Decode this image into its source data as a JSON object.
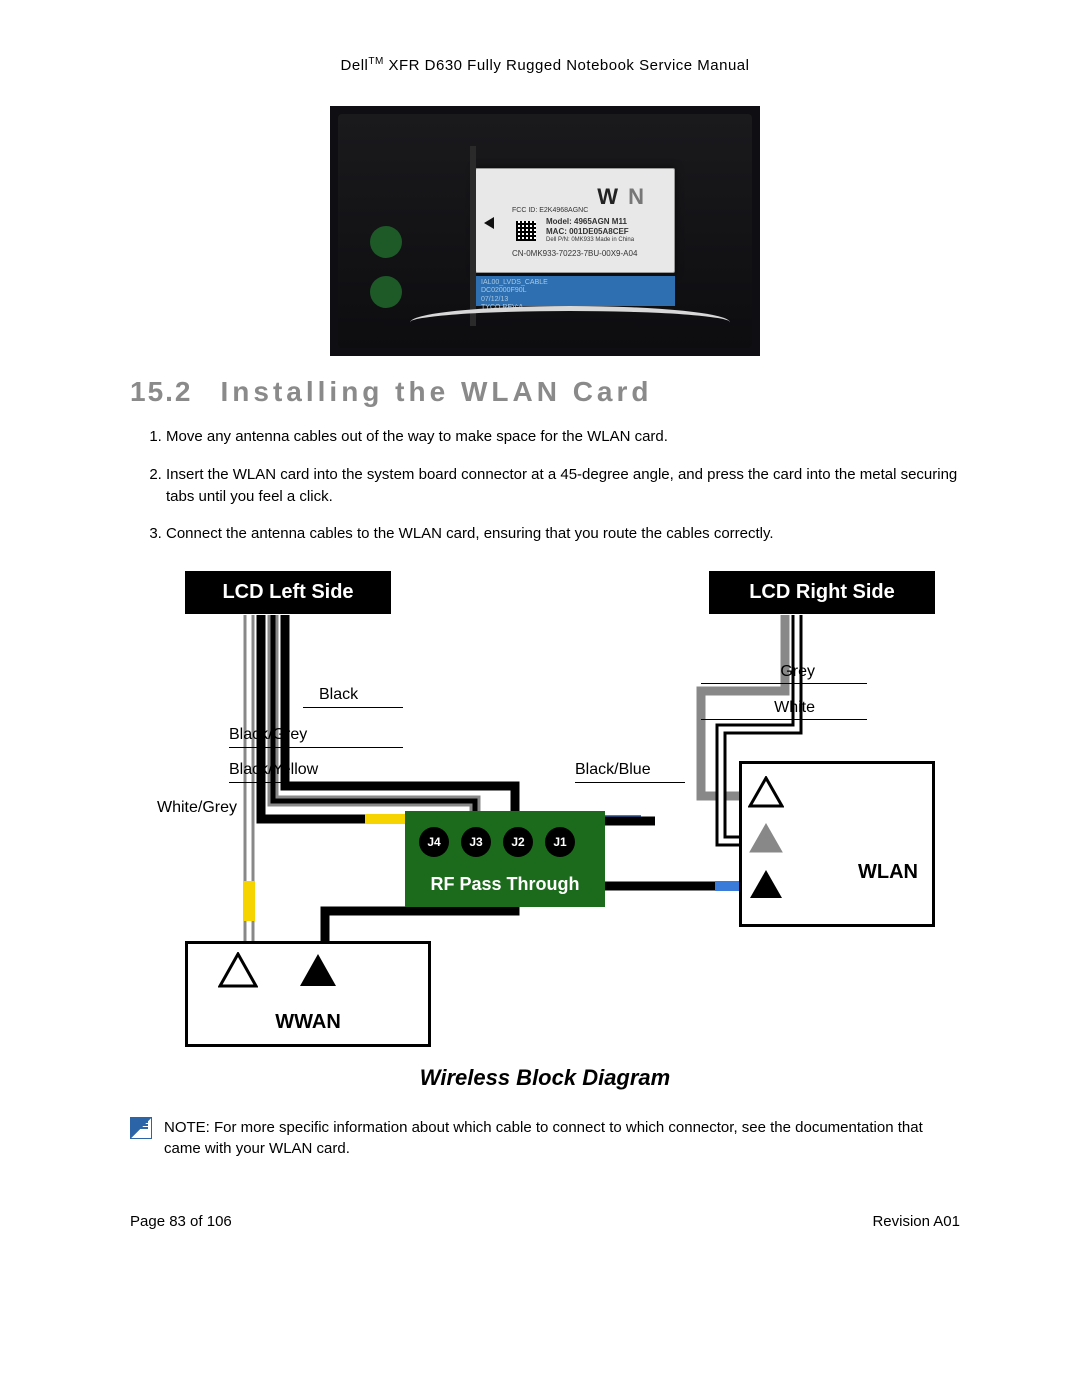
{
  "header": {
    "brand": "Dell",
    "tm": "TM",
    "rest": " XFR D630 Fully Rugged Notebook Service Manual"
  },
  "photo": {
    "card": {
      "w": "W",
      "n": "N",
      "fcc": "FCC ID: E2K4968AGNC",
      "model": "Model: 4965AGN M11",
      "mac": "MAC: 001DE05A8CEF",
      "dp": "Dell P/N: 0MK933   Made in China",
      "cn": "CN-0MK933-70223-7BU-00X9-A04"
    },
    "bottom_label": {
      "l1": "IAL00_LVDS_CABLE",
      "l2": "DC02000F90L",
      "l3": "07/12/13",
      "l4": "TYCO REV:A"
    }
  },
  "section": {
    "number": "15.2",
    "title": "Installing the WLAN Card"
  },
  "steps": [
    "Move any antenna cables out of the way to make space for the WLAN card.",
    "Insert the WLAN card into the system board connector at a 45-degree angle, and press the card into the metal securing tabs until you feel a click.",
    "Connect the antenna cables to the WLAN card, ensuring that you route the cables correctly."
  ],
  "diagram": {
    "lcd_left": "LCD Left Side",
    "lcd_right": "LCD Right Side",
    "labels": {
      "black": "Black",
      "black_grey": "Black/Grey",
      "black_yellow": "Black/Yellow",
      "white_grey": "White/Grey",
      "grey": "Grey",
      "white": "White",
      "black_blue": "Black/Blue"
    },
    "jacks": [
      "J4",
      "J3",
      "J2",
      "J1"
    ],
    "rf_label": "RF Pass Through",
    "wlan": "WLAN",
    "wwan": "WWAN",
    "caption": "Wireless Block Diagram"
  },
  "note": {
    "prefix": "NOTE:",
    "text": " For more specific information about which cable to connect to which connector, see the documentation that came with your WLAN card."
  },
  "footer": {
    "page": "Page 83 of 106",
    "rev": "Revision A01"
  }
}
